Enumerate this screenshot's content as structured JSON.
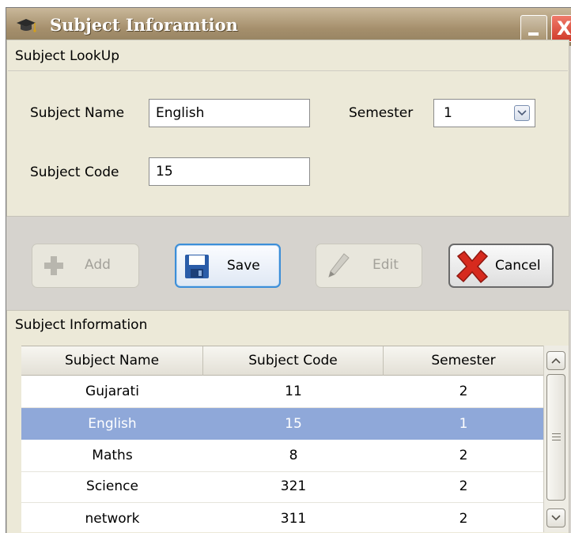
{
  "window": {
    "title": "Subject Inforamtion",
    "close_glyph": "X",
    "icon": "graduation-cap-icon"
  },
  "lookup": {
    "title": "Subject LookUp",
    "subject_name_label": "Subject Name",
    "subject_name_value": "English",
    "semester_label": "Semester",
    "semester_value": "1",
    "subject_code_label": "Subject Code",
    "subject_code_value": "15"
  },
  "toolbar": {
    "add_label": "Add",
    "save_label": "Save",
    "edit_label": "Edit",
    "cancel_label": "Cancel"
  },
  "info": {
    "title": "Subject Information",
    "columns": [
      "Subject Name",
      "Subject Code",
      "Semester"
    ],
    "rows": [
      [
        "Gujarati",
        "11",
        "2"
      ],
      [
        "English",
        "15",
        "1"
      ],
      [
        "Maths",
        "8",
        "2"
      ],
      [
        "Science",
        "321",
        "2"
      ],
      [
        "network",
        "311",
        "2"
      ]
    ],
    "selected_row": 1
  },
  "colors": {
    "selection": "#8fa8d9",
    "cancel_icon": "#d62a1e",
    "save_border": "#3c8ed8"
  }
}
